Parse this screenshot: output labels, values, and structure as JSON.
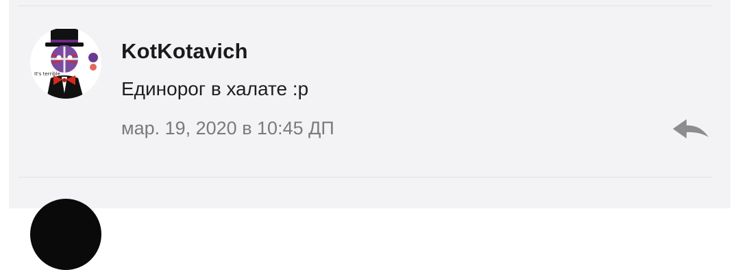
{
  "comment": {
    "username": "KotKotavich",
    "text": "Единорог в халате :p",
    "timestamp": "мар. 19, 2020 в 10:45 ДП",
    "avatar_icon": "avatar-image",
    "avatar_caption": "It's terrible",
    "reply_icon": "reply-arrow-icon"
  },
  "colors": {
    "background": "#f3f2f4",
    "username": "#1a1a1a",
    "timestamp": "#7a7a7d",
    "reply_icon": "#8d8d90"
  }
}
